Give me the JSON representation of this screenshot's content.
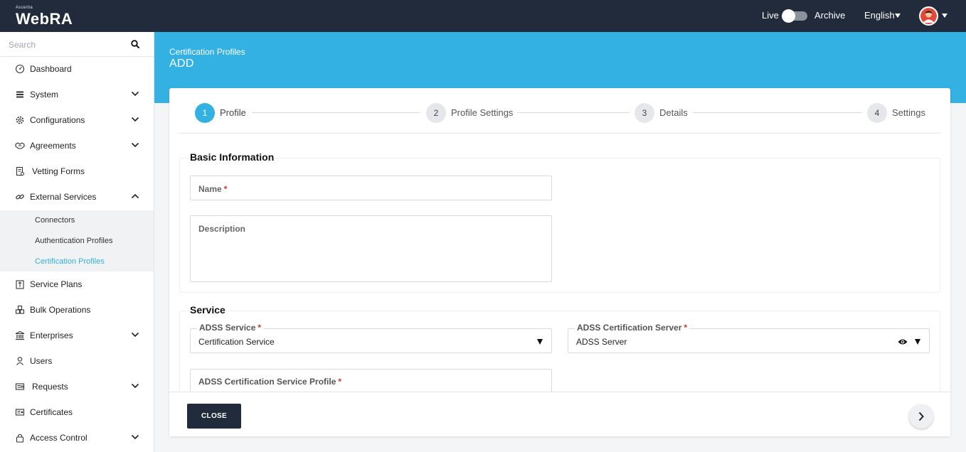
{
  "app": {
    "brand_small": "Ascertia",
    "brand_name": "WebRA",
    "live_label": "Live",
    "archive_label": "Archive",
    "language": "English"
  },
  "sidebar": {
    "search_placeholder": "Search",
    "items": [
      {
        "label": "Dashboard",
        "icon": "dashboard-icon"
      },
      {
        "label": "System",
        "icon": "system-icon"
      },
      {
        "label": "Configurations",
        "icon": "gear-icon"
      },
      {
        "label": "Agreements",
        "icon": "handshake-icon"
      },
      {
        "label": "Vetting Forms",
        "icon": "form-icon"
      },
      {
        "label": "External Services",
        "icon": "link-icon"
      },
      {
        "label": "Service Plans",
        "icon": "service-plan-icon"
      },
      {
        "label": "Bulk Operations",
        "icon": "bulk-icon"
      },
      {
        "label": "Enterprises",
        "icon": "bank-icon"
      },
      {
        "label": "Users",
        "icon": "user-icon"
      },
      {
        "label": "Requests",
        "icon": "requests-icon"
      },
      {
        "label": "Certificates",
        "icon": "certificate-icon"
      },
      {
        "label": "Access Control",
        "icon": "lock-icon"
      }
    ],
    "external_services_sub": [
      {
        "label": "Connectors"
      },
      {
        "label": "Authentication Profiles"
      },
      {
        "label": "Certification Profiles",
        "active": true
      }
    ]
  },
  "page": {
    "breadcrumb": "Certification Profiles",
    "title": "ADD"
  },
  "stepper": {
    "steps": [
      {
        "number": "1",
        "label": "Profile"
      },
      {
        "number": "2",
        "label": "Profile Settings"
      },
      {
        "number": "3",
        "label": "Details"
      },
      {
        "number": "4",
        "label": "Settings"
      }
    ],
    "active_step": 1
  },
  "basic_info": {
    "title": "Basic Information",
    "name_label": "Name",
    "description_label": "Description"
  },
  "service": {
    "title": "Service",
    "adss_service_label": "ADSS Service",
    "adss_service_value": "Certification Service",
    "adss_server_label": "ADSS Certification Server",
    "adss_server_value": "ADSS Server",
    "profile_label": "ADSS Certification Service Profile"
  },
  "footer": {
    "close_label": "CLOSE"
  },
  "colors": {
    "topbar": "#212b3c",
    "accent": "#33b1e3",
    "required": "#d0342c"
  }
}
